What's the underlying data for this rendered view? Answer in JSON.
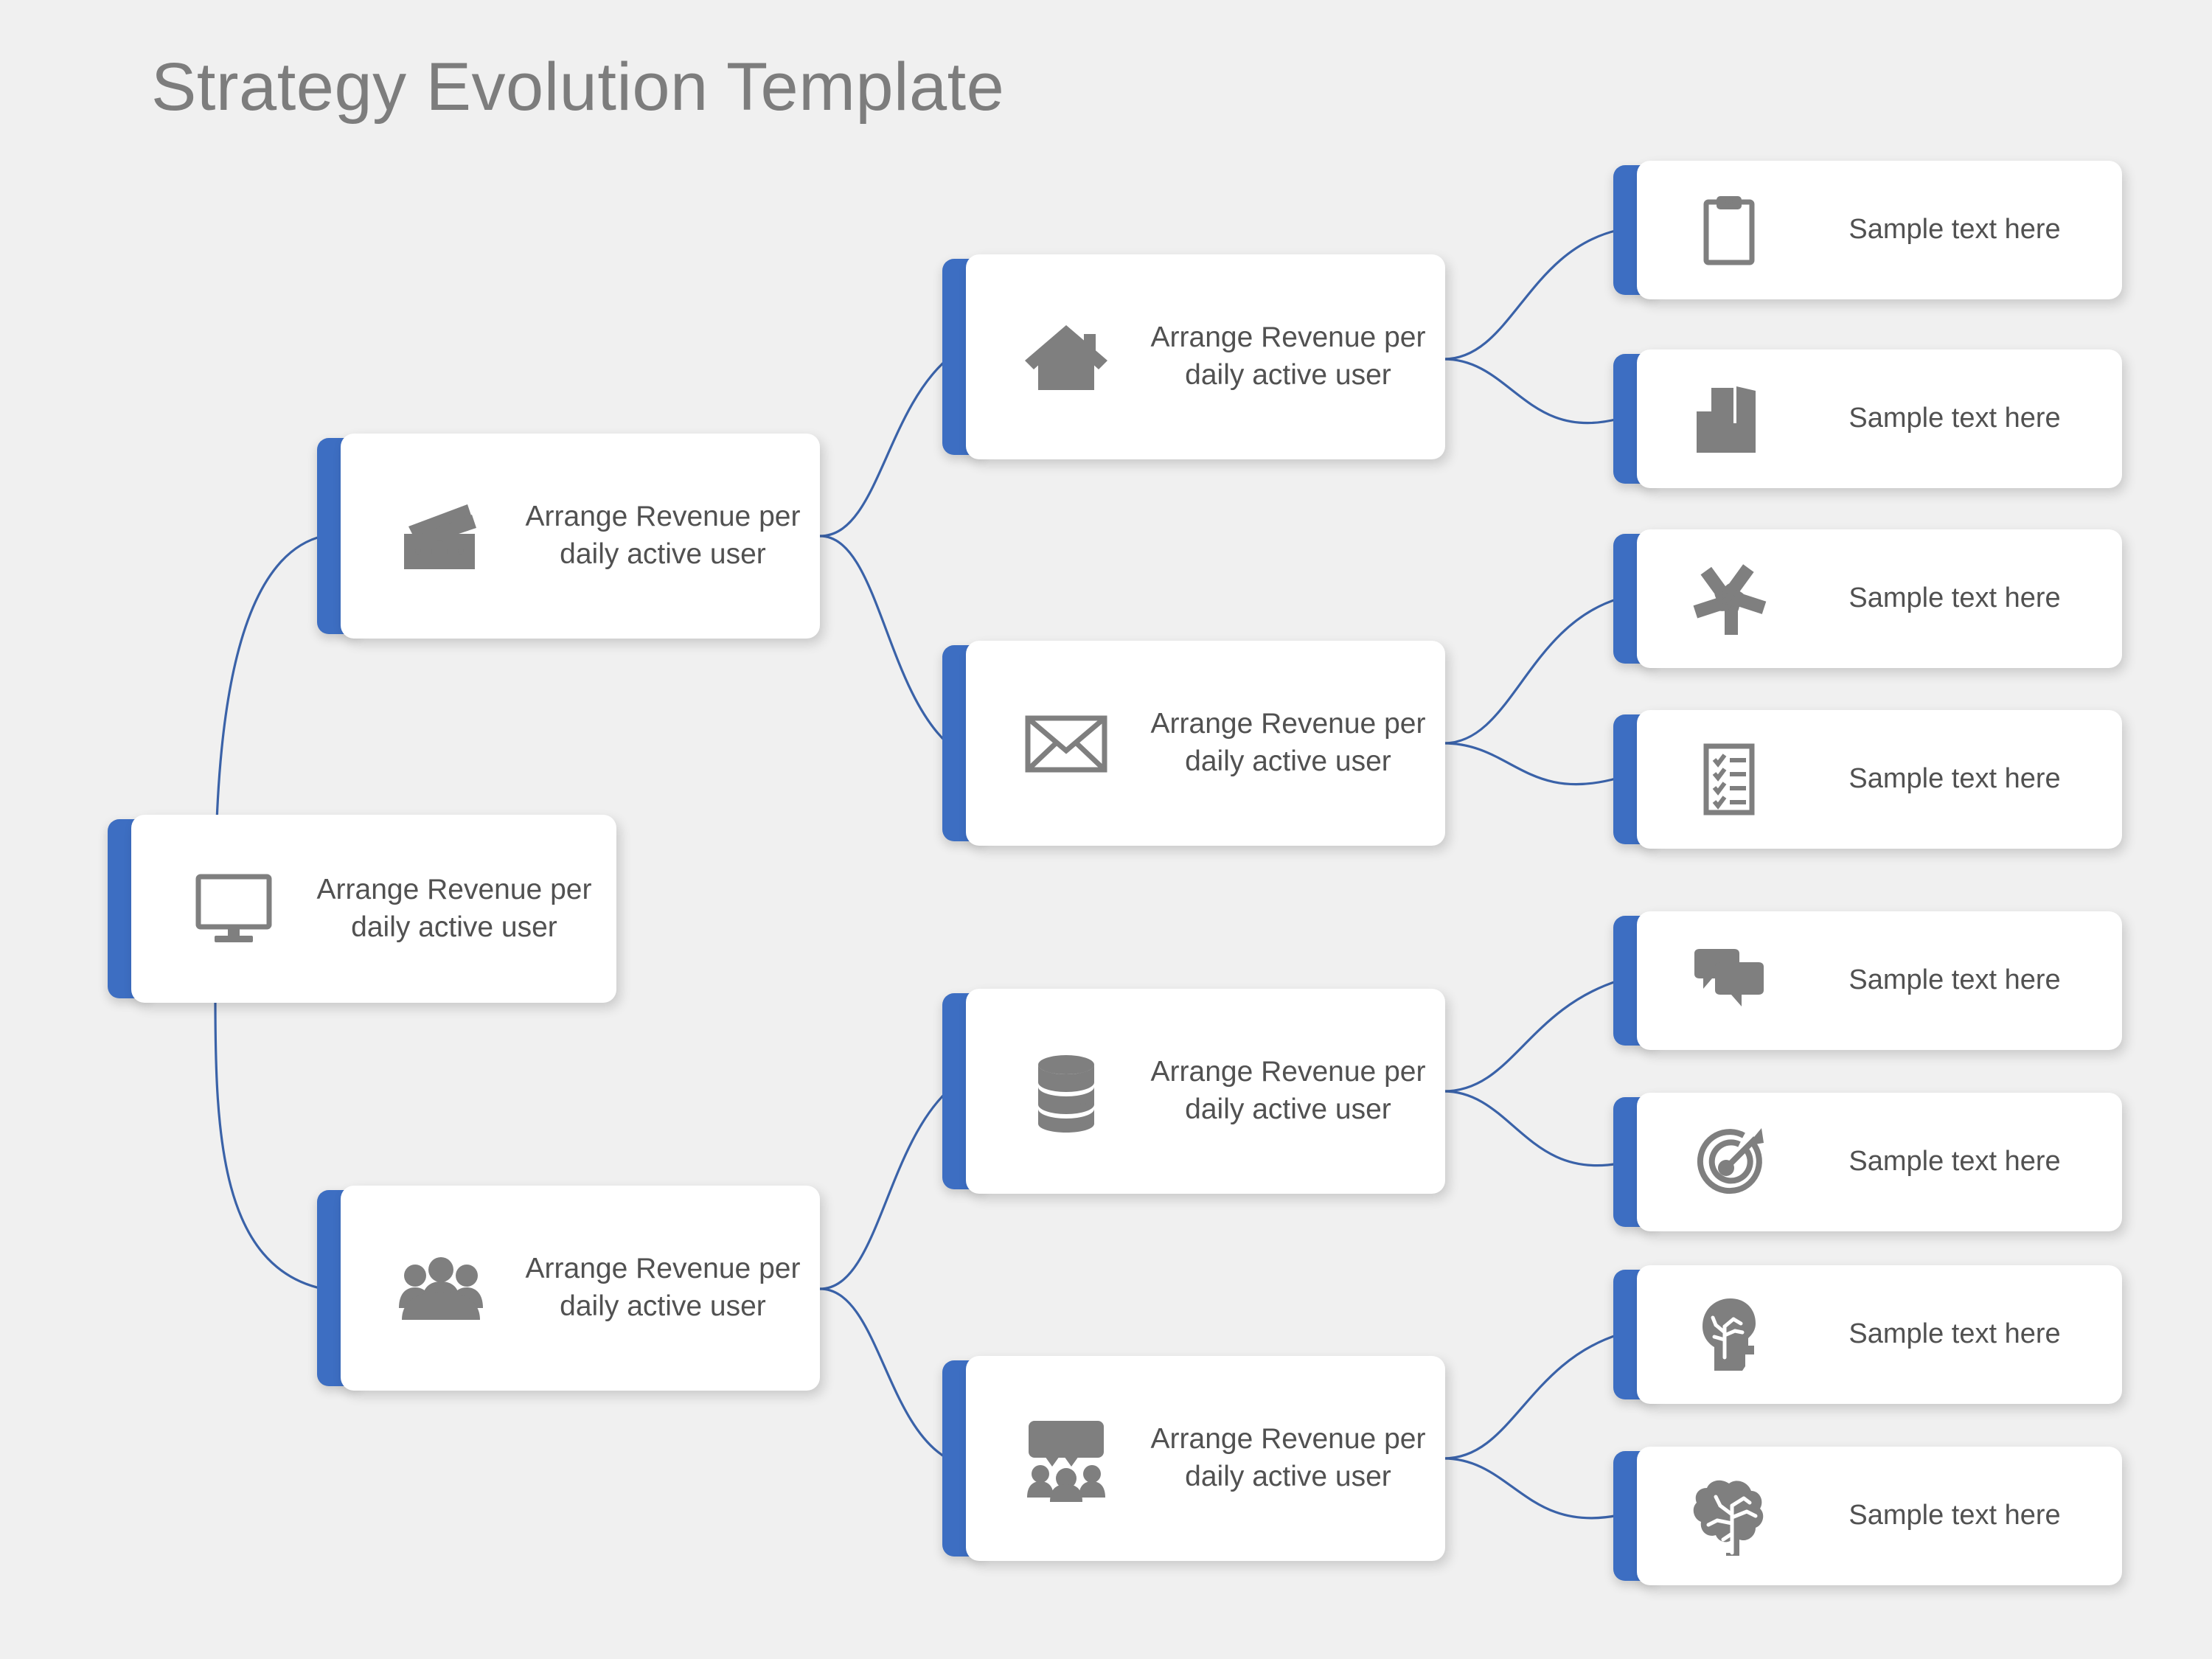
{
  "page": {
    "title": "Strategy Evolution Template",
    "background_color": "#f0f0f0",
    "accent_color": "#3d6ec2",
    "connector_color": "#3a62a8",
    "icon_color": "#7f7f7f",
    "text_color": "#515151",
    "title_color": "#7d7d7d"
  },
  "root": {
    "label": "Arrange Revenue per daily active user",
    "icon": "monitor-icon"
  },
  "branches": [
    {
      "label": "Arrange Revenue per daily active user",
      "icon": "cash-icon",
      "children": [
        {
          "label": "Arrange Revenue per daily active user",
          "icon": "house-icon",
          "leaves": [
            {
              "label": "Sample text here",
              "icon": "clipboard-icon"
            },
            {
              "label": "Sample text here",
              "icon": "buildings-icon"
            }
          ]
        },
        {
          "label": "Arrange Revenue per daily active user",
          "icon": "envelope-icon",
          "leaves": [
            {
              "label": "Sample text here",
              "icon": "teamwork-hands-icon"
            },
            {
              "label": "Sample text here",
              "icon": "checklist-icon"
            }
          ]
        }
      ]
    },
    {
      "label": "Arrange Revenue per daily active user",
      "icon": "people-group-icon",
      "children": [
        {
          "label": "Arrange Revenue per daily active user",
          "icon": "database-icon",
          "leaves": [
            {
              "label": "Sample text here",
              "icon": "chat-bubbles-icon"
            },
            {
              "label": "Sample text here",
              "icon": "target-arrow-icon"
            }
          ]
        },
        {
          "label": "Arrange Revenue per daily active user",
          "icon": "presentation-audience-icon",
          "leaves": [
            {
              "label": "Sample text here",
              "icon": "head-brain-icon"
            },
            {
              "label": "Sample text here",
              "icon": "brain-icon"
            }
          ]
        }
      ]
    }
  ]
}
